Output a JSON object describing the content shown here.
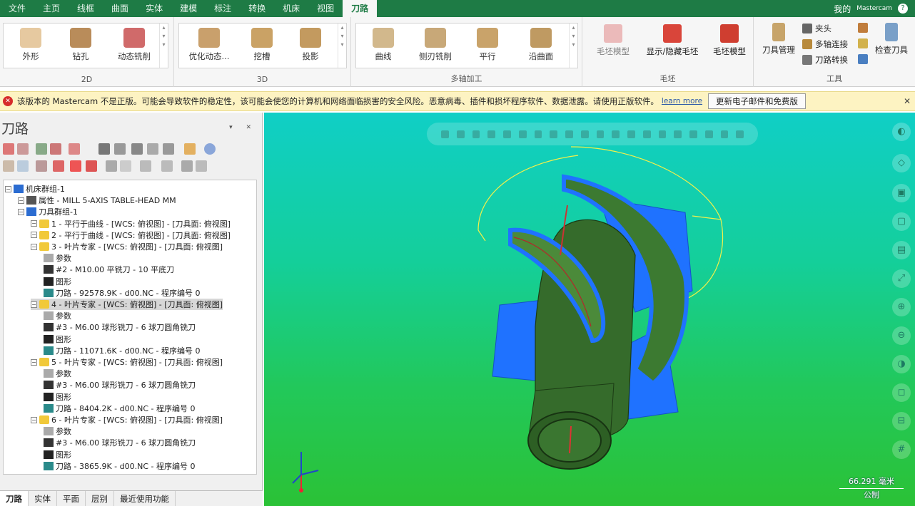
{
  "menu": {
    "items": [
      "文件",
      "主页",
      "线框",
      "曲面",
      "实体",
      "建模",
      "标注",
      "转换",
      "机床",
      "视图",
      "刀路"
    ],
    "active_index": 10,
    "right_user": "我的",
    "right_small": "Mastercam"
  },
  "ribbon": {
    "group1": {
      "label": "2D",
      "items": [
        "外形",
        "钻孔",
        "动态铣削"
      ]
    },
    "group2": {
      "label": "3D",
      "items": [
        "优化动态...",
        "挖槽",
        "投影"
      ]
    },
    "group3": {
      "label": "多轴加工",
      "items": [
        "曲线",
        "侧刃铣削",
        "平行",
        "沿曲面"
      ]
    },
    "group4": {
      "label": "毛坯",
      "items": [
        "毛坯模型",
        "显示/隐藏毛坯",
        "毛坯模型"
      ]
    },
    "group5": {
      "label": "工具",
      "big": "刀具管理",
      "small": [
        "夹头",
        "多轴连接",
        "刀路转换"
      ],
      "last": "检查刀具"
    }
  },
  "infobar": {
    "message": "该版本的 Mastercam 不是正版。可能会导致软件的稳定性，该可能会使您的计算机和网络面临损害的安全风险。恶意病毒、插件和损坏程序软件、数据泄露。请使用正版软件。",
    "link": "learn more",
    "button": "更新电子邮件和免费版",
    "close": "✕"
  },
  "panel": {
    "title": "刀路",
    "controls": "▾ ✕",
    "tree": [
      {
        "level": 0,
        "text": "机床群组-1",
        "icon": "machine"
      },
      {
        "level": 1,
        "text": "属性 - MILL 5-AXIS TABLE-HEAD MM",
        "icon": "props"
      },
      {
        "level": 1,
        "text": "刀具群组-1",
        "icon": "group"
      },
      {
        "level": 2,
        "text": "1 - 平行于曲线 - [WCS: 俯视图] - [刀具面: 俯视图]",
        "icon": "folder"
      },
      {
        "level": 2,
        "text": "2 - 平行于曲线 - [WCS: 俯视图] - [刀具面: 俯视图]",
        "icon": "folder"
      },
      {
        "level": 2,
        "text": "3 - 叶片专家 - [WCS: 俯视图] - [刀具面: 俯视图]",
        "icon": "folder"
      },
      {
        "level": 3,
        "text": "参数",
        "icon": "param"
      },
      {
        "level": 3,
        "text": "#2 - M10.00 平铣刀 - 10 平底刀",
        "icon": "tool"
      },
      {
        "level": 3,
        "text": "图形",
        "icon": "geom"
      },
      {
        "level": 3,
        "text": "刀路 - 92578.9K - d00.NC - 程序编号 0",
        "icon": "path"
      },
      {
        "level": 2,
        "text": "4 - 叶片专家 - [WCS: 俯视图] - [刀具面: 俯视图]",
        "icon": "folder",
        "selected": true
      },
      {
        "level": 3,
        "text": "参数",
        "icon": "param"
      },
      {
        "level": 3,
        "text": "#3 - M6.00 球形铣刀 - 6 球刀圆角铣刀",
        "icon": "tool"
      },
      {
        "level": 3,
        "text": "图形",
        "icon": "geom"
      },
      {
        "level": 3,
        "text": "刀路 - 11071.6K - d00.NC - 程序编号 0",
        "icon": "path"
      },
      {
        "level": 2,
        "text": "5 - 叶片专家 - [WCS: 俯视图] - [刀具面: 俯视图]",
        "icon": "folder"
      },
      {
        "level": 3,
        "text": "参数",
        "icon": "param"
      },
      {
        "level": 3,
        "text": "#3 - M6.00 球形铣刀 - 6 球刀圆角铣刀",
        "icon": "tool"
      },
      {
        "level": 3,
        "text": "图形",
        "icon": "geom"
      },
      {
        "level": 3,
        "text": "刀路 - 8404.2K - d00.NC - 程序编号 0",
        "icon": "path"
      },
      {
        "level": 2,
        "text": "6 - 叶片专家 - [WCS: 俯视图] - [刀具面: 俯视图]",
        "icon": "folder"
      },
      {
        "level": 3,
        "text": "参数",
        "icon": "param"
      },
      {
        "level": 3,
        "text": "#3 - M6.00 球形铣刀 - 6 球刀圆角铣刀",
        "icon": "tool"
      },
      {
        "level": 3,
        "text": "图形",
        "icon": "geom"
      },
      {
        "level": 3,
        "text": "刀路 - 3865.9K - d00.NC - 程序编号 0",
        "icon": "path"
      }
    ],
    "bottom_tabs": [
      "刀路",
      "实体",
      "平面",
      "层别",
      "最近使用功能"
    ],
    "active_tab": 0
  },
  "viewport": {
    "status_top": "66.291 毫米",
    "status_bottom": "公制"
  },
  "colors": {
    "menu_bg": "#1e7b45",
    "viewport_top": "#10cfc6",
    "viewport_bottom": "#2bc236",
    "blade_blue": "#1e78ff",
    "body_green": "#2f6a2c"
  }
}
